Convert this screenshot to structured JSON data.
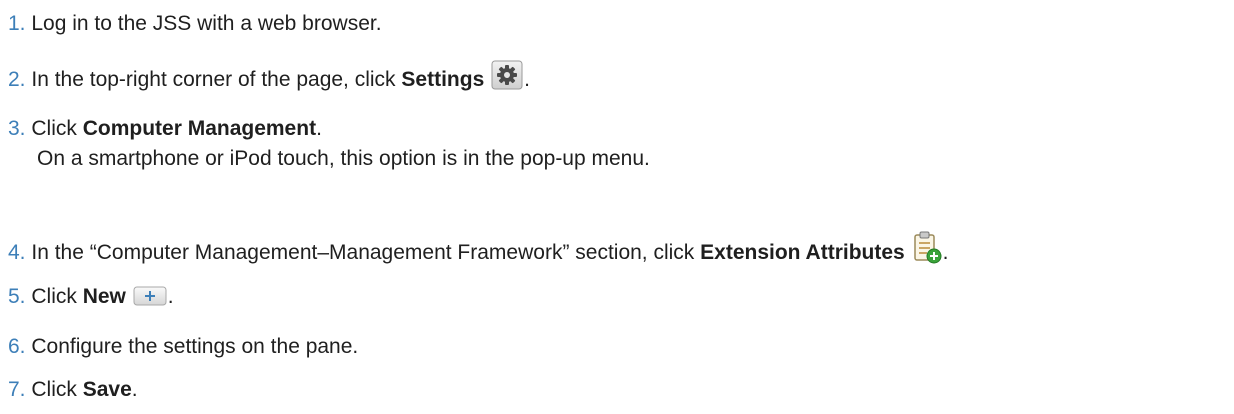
{
  "steps": [
    {
      "num": "1.",
      "pre": "Log in to the JSS with a web browser."
    },
    {
      "num": "2.",
      "pre": "In the top-right corner of the page, click ",
      "bold": "Settings",
      "icon": "gear-icon",
      "post": "."
    },
    {
      "num": "3.",
      "pre": "Click ",
      "bold": "Computer Management",
      "post": ".",
      "sub": "On a smartphone or iPod touch, this option is in the pop-up menu."
    },
    {
      "num": "4.",
      "pre": "In the “Computer Management–Management Framework” section, click ",
      "bold": "Extension Attributes",
      "icon": "clipboard-add-icon",
      "post": "."
    },
    {
      "num": "5.",
      "pre": "Click ",
      "bold": "New",
      "icon": "plus-button-icon",
      "post": "."
    },
    {
      "num": "6.",
      "pre": "Configure the settings on the pane."
    },
    {
      "num": "7.",
      "pre": "Click ",
      "bold": "Save",
      "post": "."
    }
  ],
  "colors": {
    "number": "#3d7fb8",
    "text": "#1f1f1f"
  }
}
